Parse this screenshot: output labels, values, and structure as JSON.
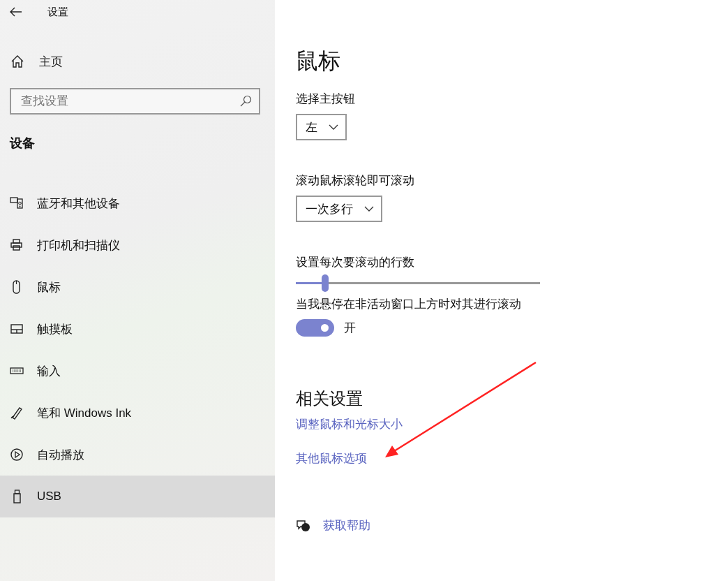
{
  "window": {
    "title": "设置"
  },
  "sidebar": {
    "home": "主页",
    "search": {
      "placeholder": "查找设置"
    },
    "section": "设备",
    "items": [
      {
        "label": "蓝牙和其他设备",
        "selected": false
      },
      {
        "label": "打印机和扫描仪",
        "selected": false
      },
      {
        "label": "鼠标",
        "selected": false
      },
      {
        "label": "触摸板",
        "selected": false
      },
      {
        "label": "输入",
        "selected": false
      },
      {
        "label": "笔和 Windows Ink",
        "selected": false
      },
      {
        "label": "自动播放",
        "selected": false
      },
      {
        "label": "USB",
        "selected": true
      }
    ]
  },
  "content": {
    "title": "鼠标",
    "primary_button": {
      "label": "选择主按钮",
      "value": "左"
    },
    "wheel_scroll": {
      "label": "滚动鼠标滚轮即可滚动",
      "value": "一次多行"
    },
    "lines_slider": {
      "label": "设置每次要滚动的行数",
      "level": 0.12
    },
    "inactive_scroll": {
      "label": "当我悬停在非活动窗口上方时对其进行滚动",
      "on": true,
      "state_text": "开"
    },
    "related": {
      "title": "相关设置",
      "links": [
        "调整鼠标和光标大小",
        "其他鼠标选项"
      ]
    },
    "help": "获取帮助"
  }
}
